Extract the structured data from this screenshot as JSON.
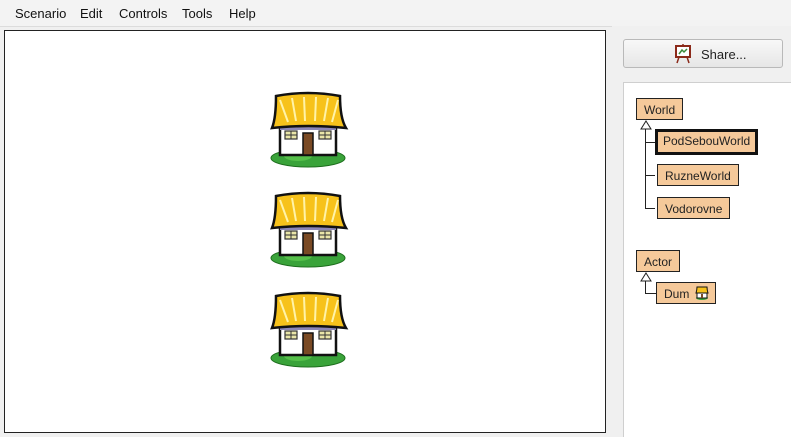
{
  "menu": {
    "items": [
      "Scenario",
      "Edit",
      "Controls",
      "Tools",
      "Help"
    ]
  },
  "share": {
    "label": "Share..."
  },
  "world": {
    "actors": [
      {
        "name": "Dum",
        "icon": "house-icon"
      },
      {
        "name": "Dum",
        "icon": "house-icon"
      },
      {
        "name": "Dum",
        "icon": "house-icon"
      }
    ]
  },
  "classes": {
    "world_root": "World",
    "world_subclasses": [
      "PodSebouWorld",
      "RuzneWorld",
      "Vodorovne"
    ],
    "selected": "PodSebouWorld",
    "actor_root": "Actor",
    "actor_subclasses": [
      "Dum"
    ]
  },
  "colors": {
    "class_box": "#f5c99a",
    "roof": "#f7c21b",
    "grass": "#3aa33a"
  }
}
